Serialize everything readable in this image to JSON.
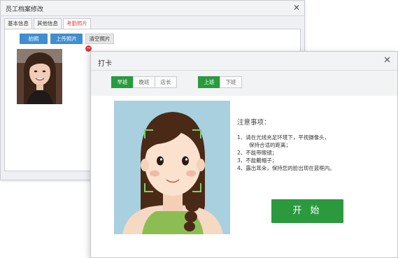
{
  "back_window": {
    "title": "员工档案修改",
    "tabs": [
      "基本信息",
      "其他信息",
      "考勤照片"
    ],
    "buttons": {
      "take_photo": "拍照",
      "upload_photo": "上传照片",
      "clear_photo": "清空照片"
    }
  },
  "dialog": {
    "title": "打卡",
    "shift_options": [
      "早班",
      "晚班",
      "店长"
    ],
    "shift_selected": "早班",
    "clock_options": [
      "上班",
      "下班"
    ],
    "clock_selected": "上班",
    "notes_title": "注意事项：",
    "notes": [
      {
        "text": "1、请在光线充足环境下，平视摄像头，",
        "sub": "保持合适的距离；"
      },
      {
        "text": "2、不能带眼镜；",
        "sub": ""
      },
      {
        "text": "3、不能戴帽子；",
        "sub": ""
      },
      {
        "text": "4、露出耳朵，保持您的脸出现在蓝框内。",
        "sub": ""
      }
    ],
    "start_label": "开 始"
  },
  "colors": {
    "accent_green": "#2b9a3e",
    "accent_blue": "#3e8ed0",
    "active_tab_red": "#e14a4a",
    "camera_bg": "#a8d0df"
  }
}
